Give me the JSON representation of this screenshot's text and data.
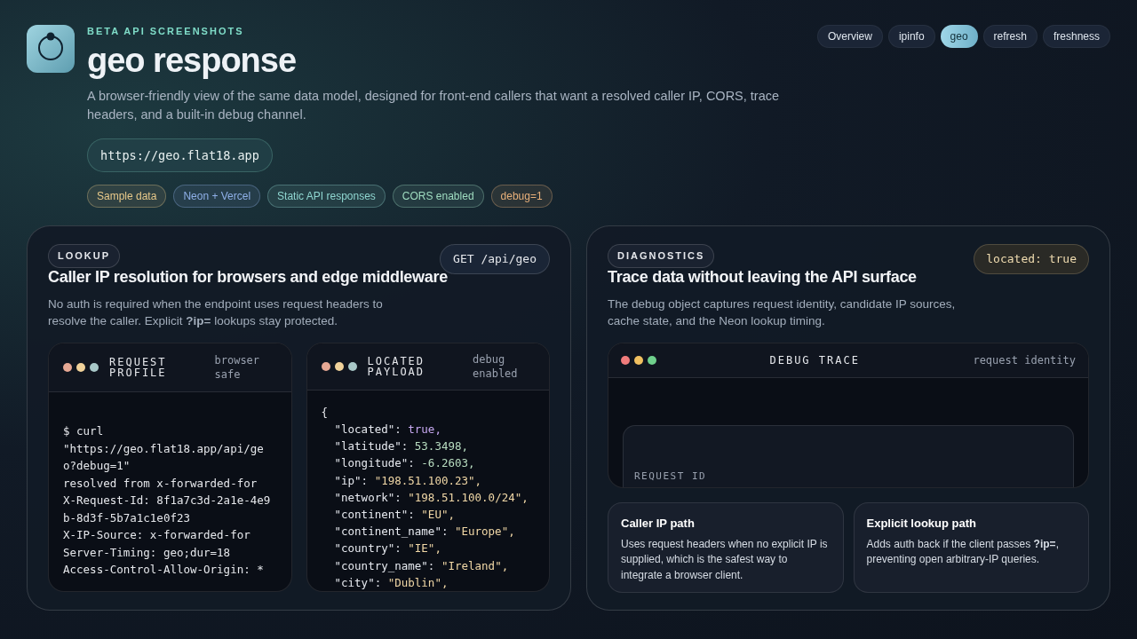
{
  "header": {
    "eyebrow": "BETA API SCREENSHOTS",
    "title": "geo response",
    "description": "A browser-friendly view of the same data model, designed for front-end callers that want a resolved caller IP, CORS, trace headers, and a built-in debug channel.",
    "url": "https://geo.flat18.app",
    "tags": [
      {
        "label": "Sample data",
        "color": "#e8c98a"
      },
      {
        "label": "Neon + Vercel",
        "color": "#8fb0e8"
      },
      {
        "label": "Static API responses",
        "color": "#8fd6d0"
      },
      {
        "label": "CORS enabled",
        "color": "#9fdcc0"
      },
      {
        "label": "debug=1",
        "color": "#e8b07a"
      }
    ]
  },
  "nav": [
    {
      "label": "Overview",
      "selected": false
    },
    {
      "label": "ipinfo",
      "selected": false
    },
    {
      "label": "geo",
      "selected": true
    },
    {
      "label": "refresh",
      "selected": false
    },
    {
      "label": "freshness",
      "selected": false
    }
  ],
  "lookup": {
    "badge": "LOOKUP",
    "method": "GET /api/geo",
    "title": "Caller IP resolution for browsers and edge middleware",
    "description": "No auth is required when the endpoint uses request headers to resolve the caller. Explicit **?ip=** lookups stay protected.",
    "terminals": [
      {
        "title": "REQUEST PROFILE",
        "note": "browser safe",
        "kind": "text",
        "lines": [
          "$ curl",
          "\"https://geo.flat18.app/api/geo?debug=1\"",
          "resolved from x-forwarded-for",
          "X-Request-Id: 8f1a7c3d-2a1e-4e9b-8d3f-5b7a1c1e0f23",
          "X-IP-Source: x-forwarded-for",
          "Server-Timing: geo;dur=18",
          "Access-Control-Allow-Origin: *"
        ]
      },
      {
        "title": "LOCATED PAYLOAD",
        "note": "debug enabled",
        "kind": "json",
        "open": "{",
        "lines": [
          {
            "key": "\"located\": ",
            "value": "true,",
            "kind": "bool"
          },
          {
            "key": "\"latitude\": ",
            "value": "53.3498,",
            "kind": "number"
          },
          {
            "key": "\"longitude\": ",
            "value": "-6.2603,",
            "kind": "number"
          },
          {
            "key": "\"ip\": ",
            "value": "\"198.51.100.23\",",
            "kind": "string"
          },
          {
            "key": "\"network\": ",
            "value": "\"198.51.100.0/24\",",
            "kind": "string"
          },
          {
            "key": "\"continent\": ",
            "value": "\"EU\",",
            "kind": "string"
          },
          {
            "key": "\"continent_name\": ",
            "value": "\"Europe\",",
            "kind": "string"
          },
          {
            "key": "\"country\": ",
            "value": "\"IE\",",
            "kind": "string"
          },
          {
            "key": "\"country_name\": ",
            "value": "\"Ireland\",",
            "kind": "string"
          },
          {
            "key": "\"city\": ",
            "value": "\"Dublin\",",
            "kind": "string"
          }
        ]
      }
    ]
  },
  "diagnostics": {
    "badge": "DIAGNOSTICS",
    "status": "located: true",
    "title": "Trace data without leaving the API surface",
    "description": "The debug object captures request identity, candidate IP sources, cache state, and the Neon lookup timing.",
    "trace": {
      "title": "DEBUG TRACE",
      "note": "request identity",
      "field_label": "REQUEST ID"
    },
    "cards": [
      {
        "title": "Caller IP path",
        "body": "Uses request headers when no explicit IP is supplied, which is the safest way to integrate a browser client."
      },
      {
        "title": "Explicit lookup path",
        "body": "Adds auth back if the client passes **?ip=**, preventing open arbitrary-IP queries."
      }
    ]
  }
}
